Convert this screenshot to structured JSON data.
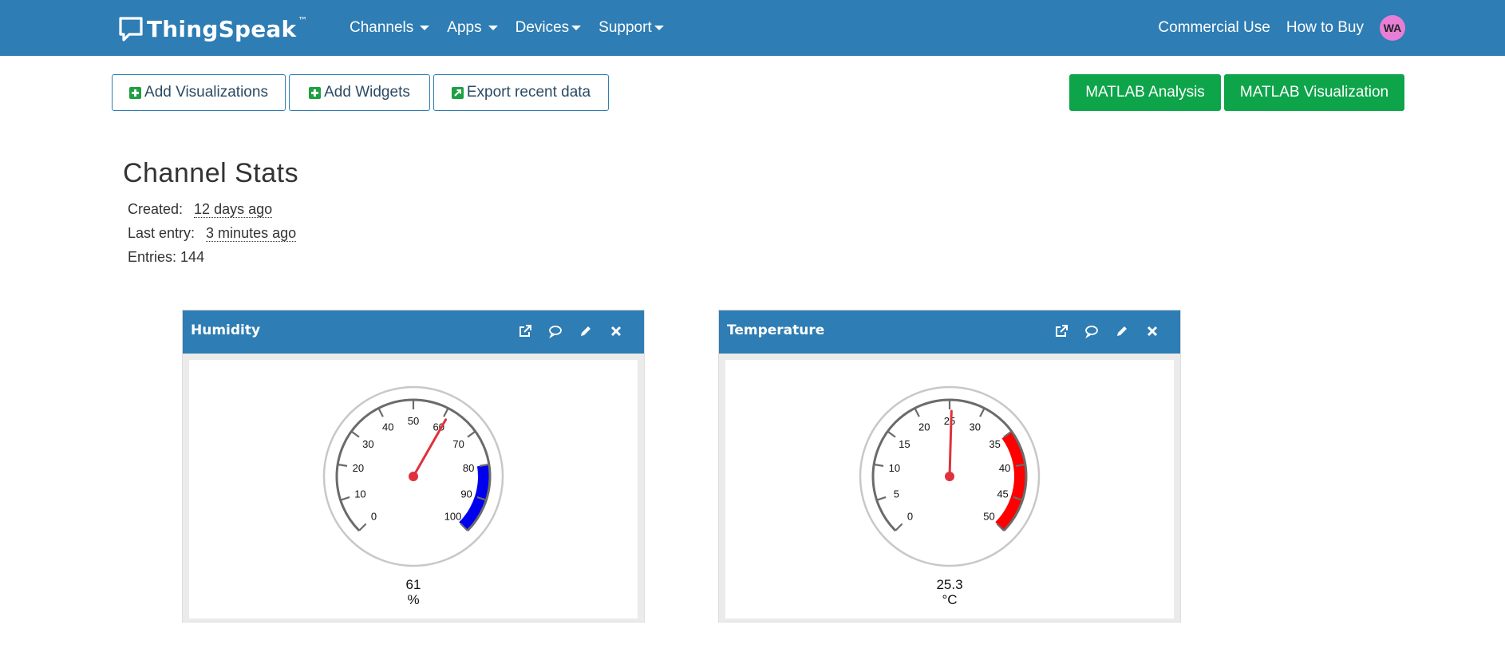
{
  "brand": {
    "name": "ThingSpeak",
    "trademark": "™"
  },
  "nav": {
    "menus": [
      "Channels",
      "Apps",
      "Devices",
      "Support"
    ],
    "right_links": [
      "Commercial Use",
      "How to Buy"
    ],
    "avatar_initials": "WA"
  },
  "toolbar": {
    "add_visualizations": "Add Visualizations",
    "add_widgets": "Add Widgets",
    "export_recent_data": "Export recent data",
    "matlab_analysis": "MATLAB Analysis",
    "matlab_visualization": "MATLAB Visualization"
  },
  "stats": {
    "title": "Channel Stats",
    "created_label": "Created:",
    "created_value": "12 days ago",
    "last_entry_label": "Last entry:",
    "last_entry_value": "3 minutes ago",
    "entries_label": "Entries:",
    "entries_value": "144"
  },
  "widgets": [
    {
      "title": "Humidity",
      "value": 61,
      "value_text": "61",
      "unit": "%",
      "min": 0,
      "max": 100,
      "tick_labels": [
        "0",
        "10",
        "20",
        "30",
        "40",
        "50",
        "60",
        "70",
        "80",
        "90",
        "100"
      ],
      "band_from": 80,
      "band_to": 100,
      "band_color": "#0000ee"
    },
    {
      "title": "Temperature",
      "value": 25.3,
      "value_text": "25.3",
      "unit": "°C",
      "min": 0,
      "max": 50,
      "tick_labels": [
        "0",
        "5",
        "10",
        "15",
        "20",
        "25",
        "30",
        "35",
        "40",
        "45",
        "50"
      ],
      "band_from": 35,
      "band_to": 50,
      "band_color": "#ff0000"
    }
  ],
  "colors": {
    "navbar": "#2e7db4",
    "green_button": "#0ea44a",
    "needle": "#e0313d"
  }
}
